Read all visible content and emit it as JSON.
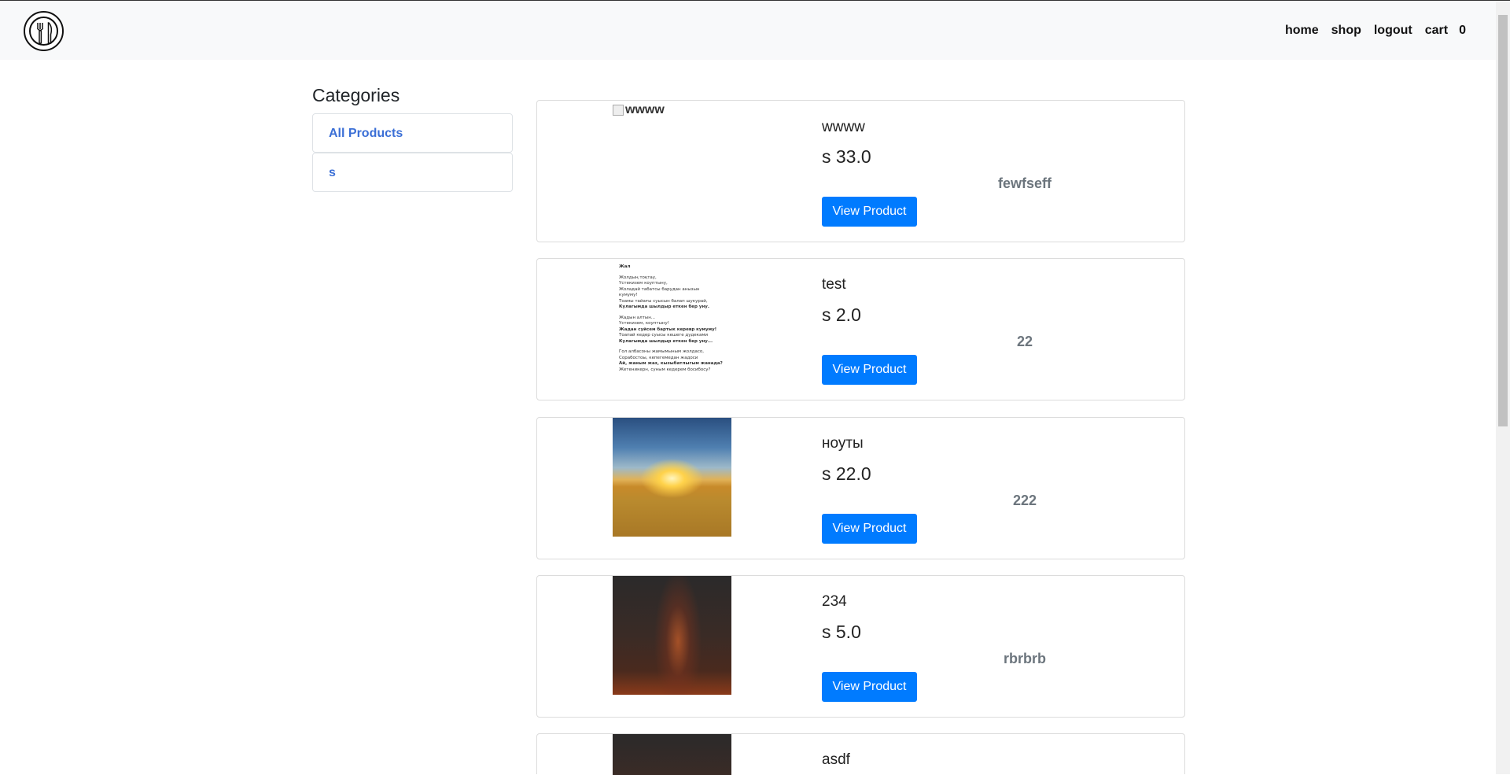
{
  "nav": {
    "logo_icon": "utensils-logo-icon",
    "links": [
      "home",
      "shop",
      "logout",
      "cart"
    ],
    "cart_count": "0"
  },
  "categories": {
    "title": "Categories",
    "items": [
      "All Products",
      "s"
    ]
  },
  "products": [
    {
      "name": "wwww",
      "price": "s 33.0",
      "description": "fewfseff",
      "image_alt": "wwww",
      "button": "View Product"
    },
    {
      "name": "test",
      "price": "s 2.0",
      "description": "22",
      "image": "text-document-thumbnail",
      "button": "View Product"
    },
    {
      "name": "ноуты",
      "price": "s 22.0",
      "description": "222",
      "image": "wheat-field-sunset-photo",
      "button": "View Product"
    },
    {
      "name": "234",
      "price": "s 5.0",
      "description": "rbrbrb",
      "image": "milky-way-night-photo",
      "button": "View Product"
    },
    {
      "name": "asdf",
      "image": "milky-way-night-photo"
    }
  ],
  "doc_text": {
    "title": "Жал",
    "lines": [
      "Жолдың тоқтау,",
      "Үстекизем коуптыну,",
      "Жоладай табатсы барудан анызын",
      "кумуму!",
      "Тоамы тайағы суысын балап шукурай,",
      "Кулагымда шылдыр еткен бер уну.",
      "Жадын алтын...",
      "Үстекизем, коуптыну!",
      "Жадан суйсем бартык керевр кумуму!",
      "Тоапай кедер суысы кешеге дудеками",
      "Кулагымда шылдыр еткен бер уну...",
      "Гол албасоны жамымыным жолдасо,",
      "Сорабостоы, кепегемедан жадоси",
      "Ай, жаным жаз, кызыбатлыгым жанада?",
      "Жетеникерн, суным кедерем босибосу?"
    ]
  },
  "colors": {
    "primary_button": "#007bff",
    "category_link": "#3b6fd6",
    "muted_text": "#6c757d",
    "navbar_bg": "#f8f9fa"
  }
}
